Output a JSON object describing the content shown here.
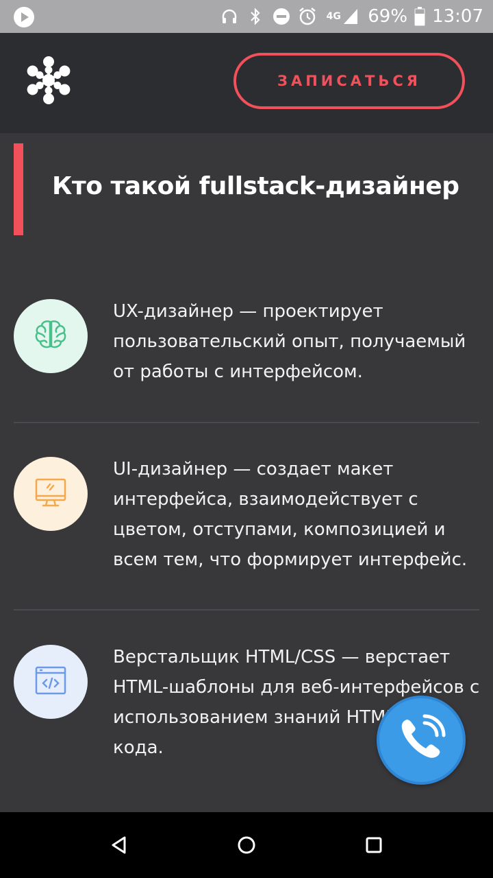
{
  "status_bar": {
    "battery": "69%",
    "time": "13:07",
    "network": "4G"
  },
  "header": {
    "cta_label": "ЗАПИСАТЬСЯ"
  },
  "section": {
    "title": "Кто такой fullstack-дизайнер",
    "items": [
      {
        "icon": "brain-icon",
        "icon_bg": "#e3f7ee",
        "icon_color": "#48c08a",
        "text": "UX-дизайнер — проектирует пользовательский опыт, получаемый от работы с интерфейсом."
      },
      {
        "icon": "monitor-icon",
        "icon_bg": "#fdf0dc",
        "icon_color": "#f5a84a",
        "text": "UI-дизайнер — создает макет интерфейса, взаимодействует с цветом, отступами, композицией и всем тем, что формирует интерфейс."
      },
      {
        "icon": "code-window-icon",
        "icon_bg": "#e6eefc",
        "icon_color": "#6b9ae6",
        "text": "Верстальщик HTML/CSS — верстает HTML-шаблоны для веб-интерфейсов с использованием знаний HTML/CSS-кода."
      }
    ]
  },
  "colors": {
    "accent": "#f2515c",
    "background": "#38383b",
    "header_bg": "#2c2d30",
    "call_button": "#3c9be6"
  }
}
